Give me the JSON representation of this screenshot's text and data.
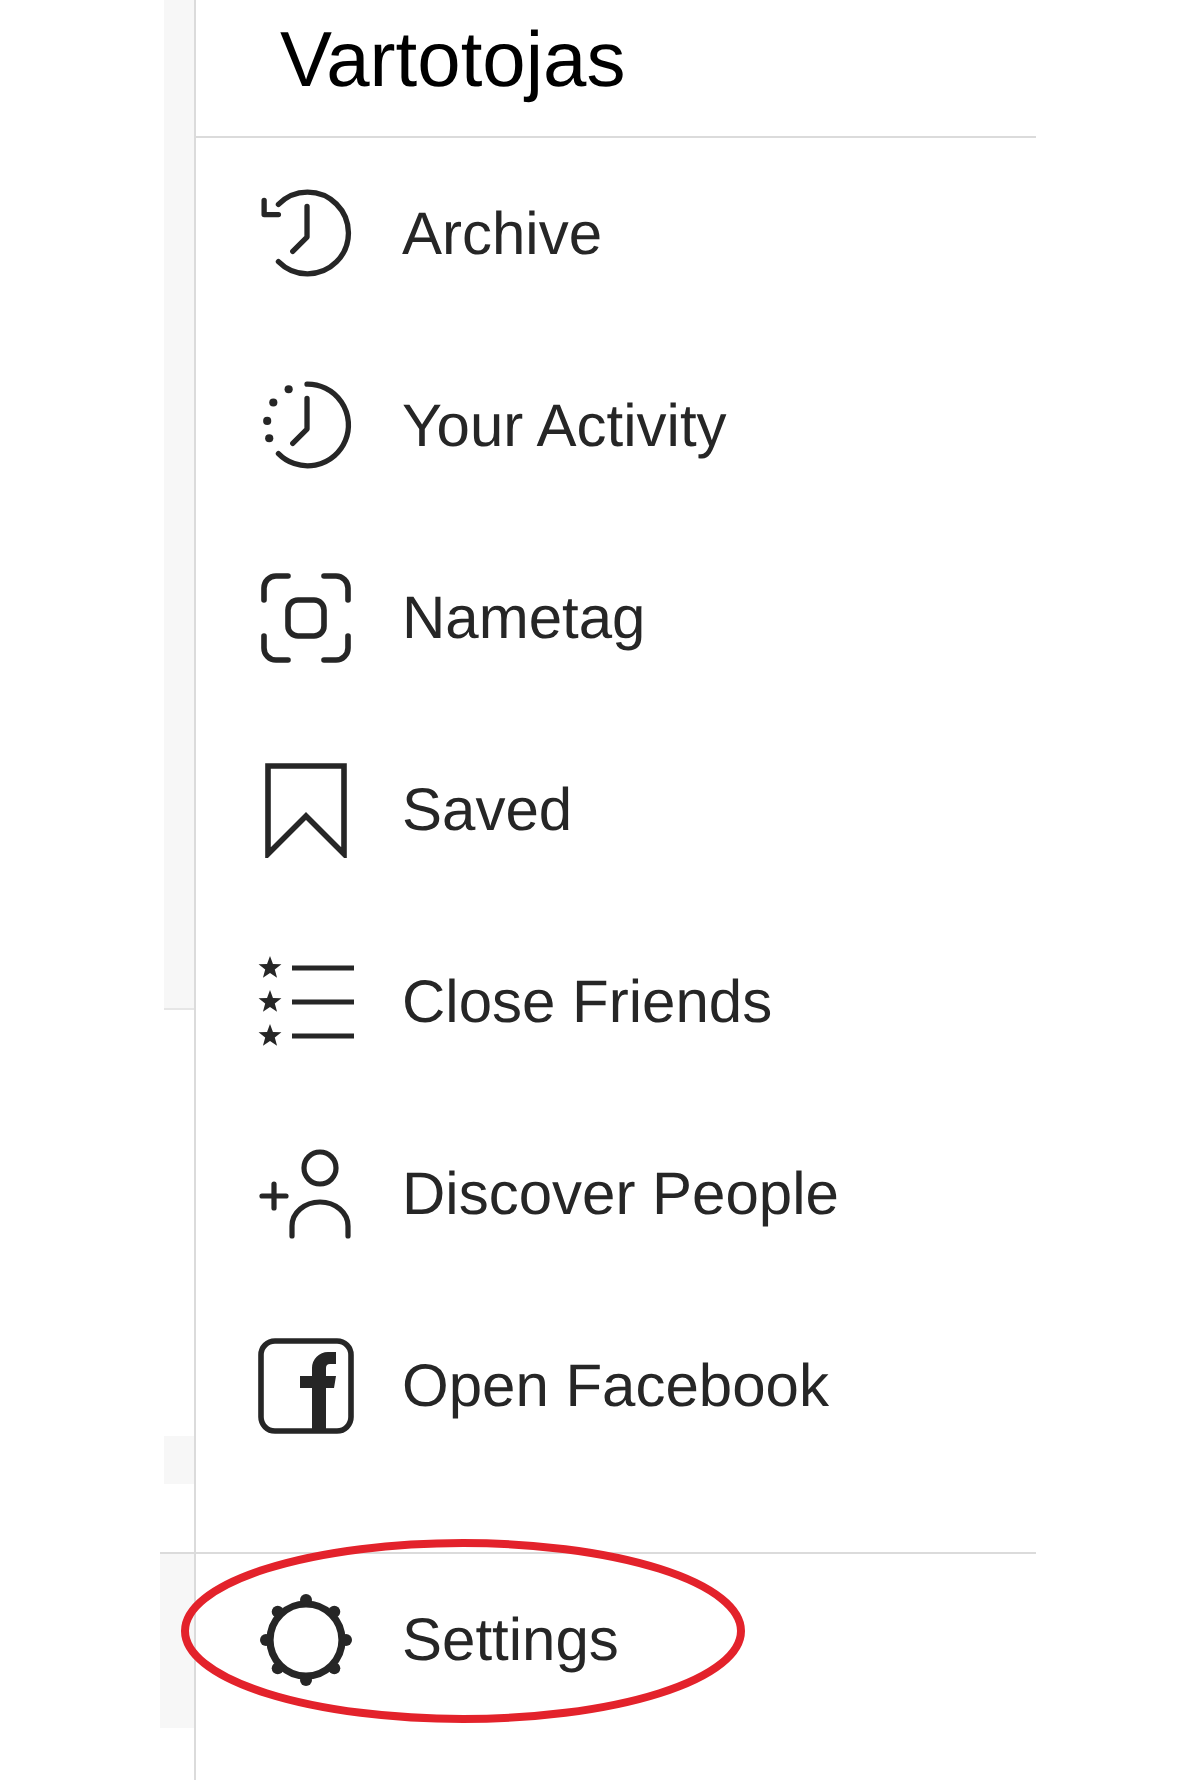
{
  "header": {
    "title": "Vartotojas"
  },
  "menu": {
    "items": [
      {
        "label": "Archive"
      },
      {
        "label": "Your Activity"
      },
      {
        "label": "Nametag"
      },
      {
        "label": "Saved"
      },
      {
        "label": "Close Friends"
      },
      {
        "label": "Discover People"
      },
      {
        "label": "Open Facebook"
      }
    ]
  },
  "footer": {
    "items": [
      {
        "label": "Settings",
        "highlighted": true
      }
    ]
  }
}
